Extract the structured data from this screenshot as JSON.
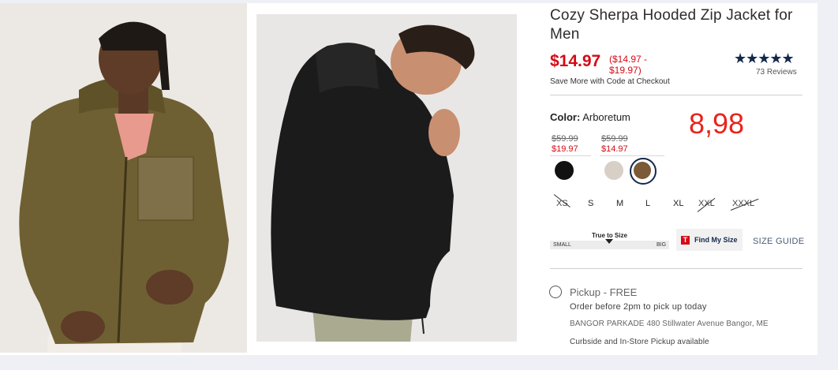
{
  "product": {
    "title": "Cozy Sherpa Hooded Zip Jacket for Men",
    "price": "$14.97",
    "price_range": "($14.97 - $19.97)",
    "promo_note": "Save More with Code at Checkout",
    "rating_stars": "★★★★★",
    "reviews": "73 Reviews"
  },
  "color": {
    "label": "Color:",
    "selected": "Arboretum",
    "price_groups": [
      {
        "old": "$59.99",
        "new": "$19.97"
      },
      {
        "old": "$59.99",
        "new": "$14.97"
      }
    ],
    "swatches": [
      {
        "name": "black",
        "hex": "#111111"
      },
      {
        "name": "beige",
        "hex": "#d8cfc6"
      },
      {
        "name": "arboretum",
        "hex": "#7a5a37"
      }
    ]
  },
  "overlay_number": "8,98",
  "sizes": [
    {
      "label": "XS",
      "available": false
    },
    {
      "label": "S",
      "available": true
    },
    {
      "label": "M",
      "available": true
    },
    {
      "label": "L",
      "available": true
    },
    {
      "label": "XL",
      "available": true
    },
    {
      "label": "XXL",
      "available": false
    },
    {
      "label": "XXXL",
      "available": false
    }
  ],
  "fit": {
    "label": "True to Size",
    "small": "SMALL",
    "big": "BIG",
    "find_my_size": "Find My Size",
    "find_my_size_logo": "T",
    "size_guide": "SIZE GUIDE"
  },
  "pickup": {
    "title": "Pickup - FREE",
    "note": "Order before 2pm to pick up today",
    "store": "BANGOR PARKADE 480 Stillwater Avenue  Bangor, ME",
    "availability": "Curbside and In-Store Pickup available"
  },
  "colors": {
    "sale_red": "#d50a16",
    "navy": "#13294b",
    "jacket_olive": "#6f6033",
    "jacket_black": "#1b1b1b"
  }
}
